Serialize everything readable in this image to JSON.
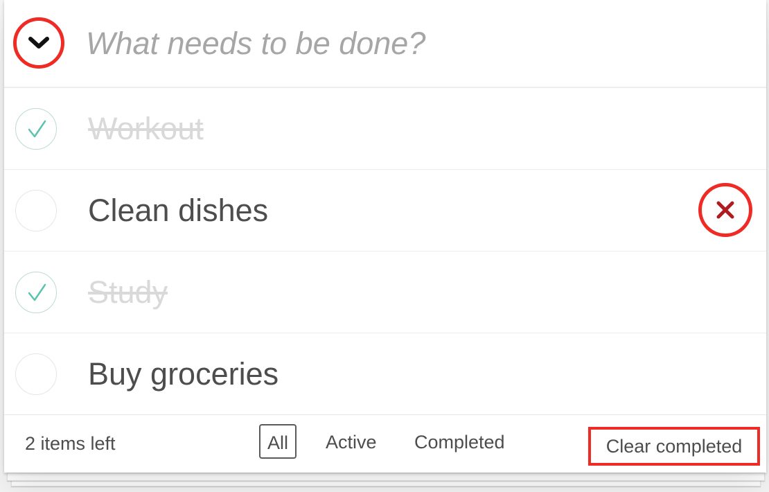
{
  "new_todo": {
    "placeholder": "What needs to be done?",
    "toggle_all_icon": "chevron-down-icon"
  },
  "todos": [
    {
      "title": "Workout",
      "completed": true
    },
    {
      "title": "Clean dishes",
      "completed": false
    },
    {
      "title": "Study",
      "completed": true
    },
    {
      "title": "Buy groceries",
      "completed": false
    }
  ],
  "destroy_icon": "close-icon",
  "footer": {
    "count": "2 items left",
    "filters": [
      {
        "label": "All",
        "selected": true
      },
      {
        "label": "Active",
        "selected": false
      },
      {
        "label": "Completed",
        "selected": false
      }
    ],
    "clear_label": "Clear completed"
  },
  "colors": {
    "highlight": "#ee2b24",
    "check": "#5dc2af",
    "completed_text": "#d9d9d9",
    "text": "#4d4d4d",
    "placeholder": "#a6a6a6",
    "destroy_x": "#af1b20"
  }
}
